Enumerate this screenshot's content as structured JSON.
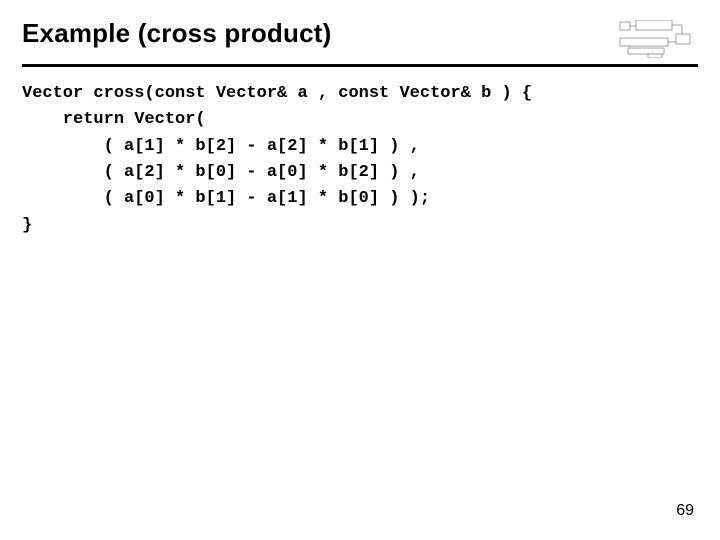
{
  "title": "Example (cross product)",
  "code": {
    "l1": "Vector cross(const Vector& a , const Vector& b ) {",
    "l2": "    return Vector(",
    "l3": "        ( a[1] * b[2] - a[2] * b[1] ) ,",
    "l4": "        ( a[2] * b[0] - a[0] * b[2] ) ,",
    "l5": "        ( a[0] * b[1] - a[1] * b[0] ) );",
    "l6": "}"
  },
  "page_number": "69"
}
